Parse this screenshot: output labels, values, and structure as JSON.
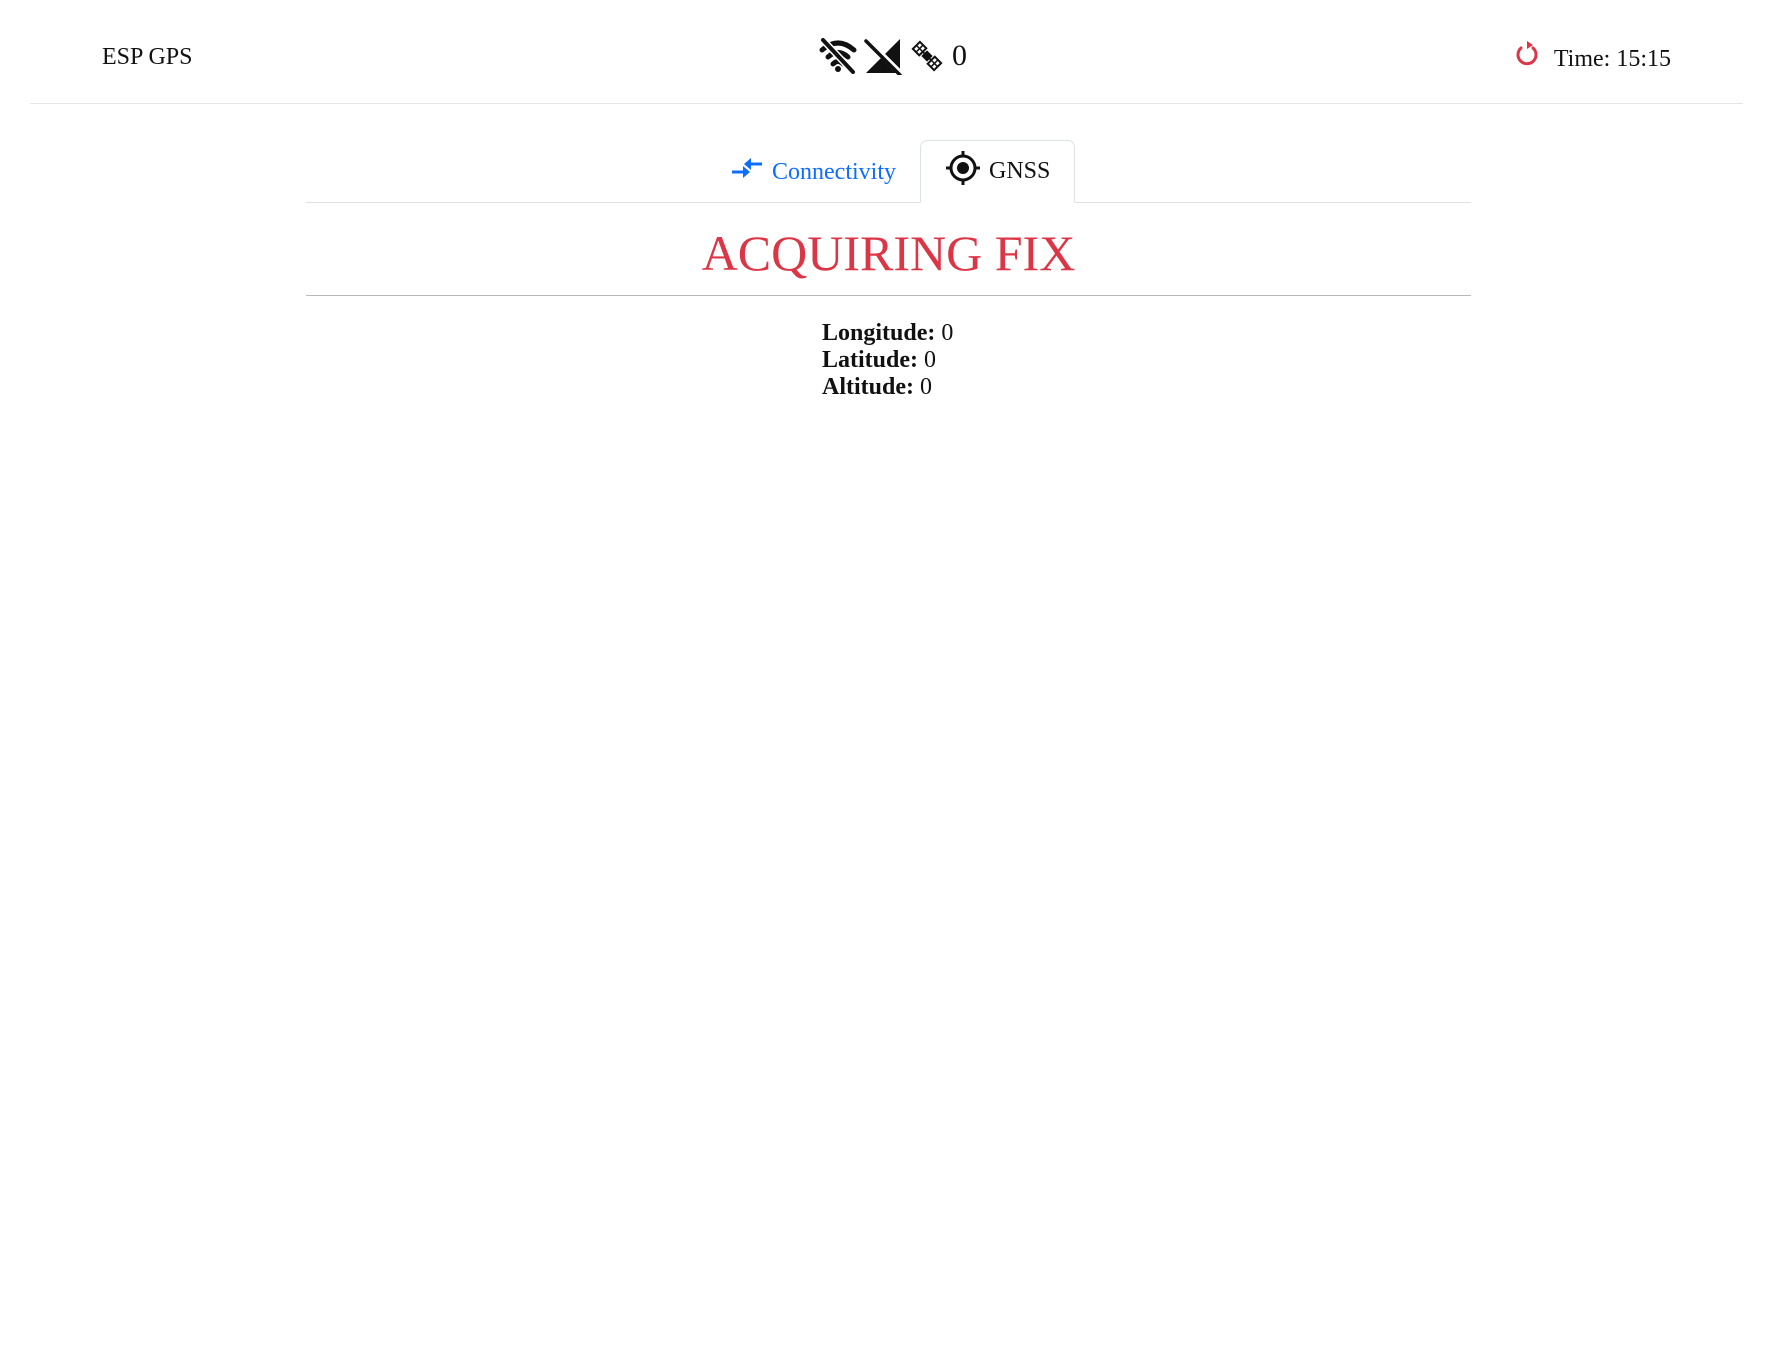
{
  "header": {
    "brand": "ESP GPS",
    "status_icons": [
      "wifi-off-icon",
      "cellular-off-icon",
      "satellite-icon"
    ],
    "satellite_count": "0",
    "time_label": "Time:",
    "time_value": "15:15",
    "refresh_icon": "refresh-icon",
    "refresh_color": "#dc3545"
  },
  "tabs": [
    {
      "label": "Connectivity",
      "icon": "swap-arrows-icon",
      "active": false,
      "color": "#0d6efd"
    },
    {
      "label": "GNSS",
      "icon": "crosshair-icon",
      "active": true,
      "color": "#111111"
    }
  ],
  "gnss": {
    "status": "ACQUIRING FIX",
    "status_color": "#dc3545",
    "longitude_label": "Longitude:",
    "longitude_value": "0",
    "latitude_label": "Latitude:",
    "latitude_value": "0",
    "altitude_label": "Altitude:",
    "altitude_value": "0"
  }
}
